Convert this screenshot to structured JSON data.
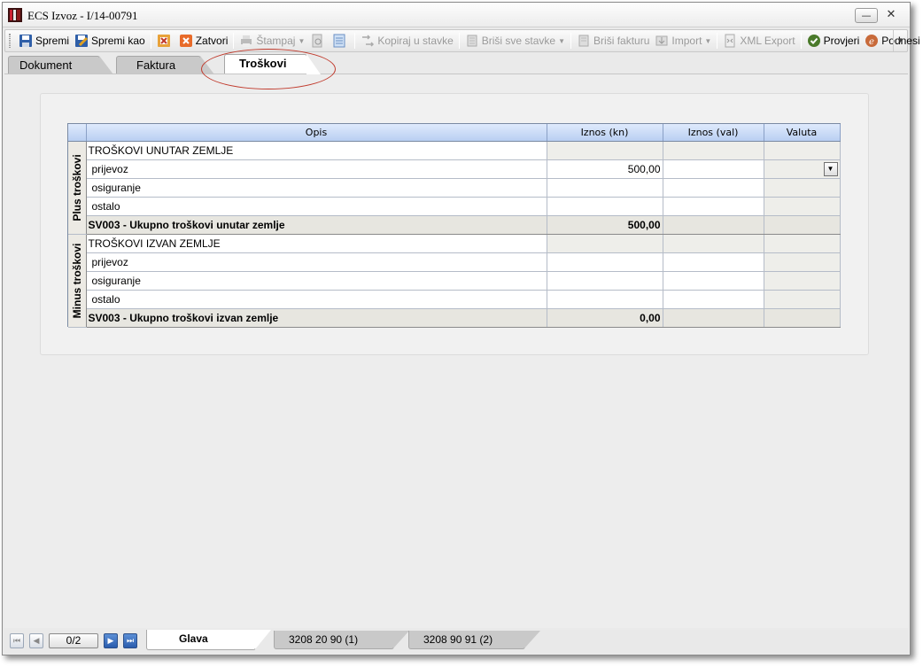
{
  "window": {
    "title": "ECS Izvoz - I/14-00791",
    "minimize_glyph": "—",
    "close_glyph": "✕"
  },
  "toolbar": {
    "save": "Spremi",
    "save_as": "Spremi kao",
    "close": "Zatvori",
    "print": "Štampaj",
    "copy_to_items": "Kopiraj u stavke",
    "delete_all_items": "Briši sve stavke",
    "delete_invoice": "Briši fakturu",
    "import": "Import",
    "xml_export": "XML Export",
    "check": "Provjeri",
    "submit": "Podnesi",
    "caret": "▼"
  },
  "tabs": {
    "dokument": "Dokument",
    "faktura": "Faktura",
    "troskovi": "Troškovi"
  },
  "grid": {
    "columns": {
      "opis": "Opis",
      "iznos_kn": "Iznos (kn)",
      "iznos_val": "Iznos (val)",
      "valuta": "Valuta"
    },
    "plus": {
      "group_label": "Plus troškovi",
      "header": "TROŠKOVI UNUTAR ZEMLJE",
      "rows": [
        {
          "label": "prijevoz",
          "kn": "500,00",
          "val": ""
        },
        {
          "label": "osiguranje",
          "kn": "",
          "val": ""
        },
        {
          "label": "ostalo",
          "kn": "",
          "val": ""
        }
      ],
      "total_label": "SV003 - Ukupno troškovi unutar zemlje",
      "total_value": "500,00"
    },
    "minus": {
      "group_label": "Minus troškovi",
      "header": "TROŠKOVI IZVAN ZEMLJE",
      "rows": [
        {
          "label": "prijevoz",
          "kn": "",
          "val": ""
        },
        {
          "label": "osiguranje",
          "kn": "",
          "val": ""
        },
        {
          "label": "ostalo",
          "kn": "",
          "val": ""
        }
      ],
      "total_label": "SV003 - Ukupno troškovi izvan zemlje",
      "total_value": "0,00"
    },
    "dropdown_glyph": "▼"
  },
  "bottom": {
    "pager": "0/2",
    "tabs": [
      "Glava",
      "3208 20 90  (1)",
      "3208 90 91  (2)"
    ],
    "first_glyph": "⏮",
    "prev_glyph": "◀",
    "next_glyph": "▶",
    "last_glyph": "⏭"
  }
}
